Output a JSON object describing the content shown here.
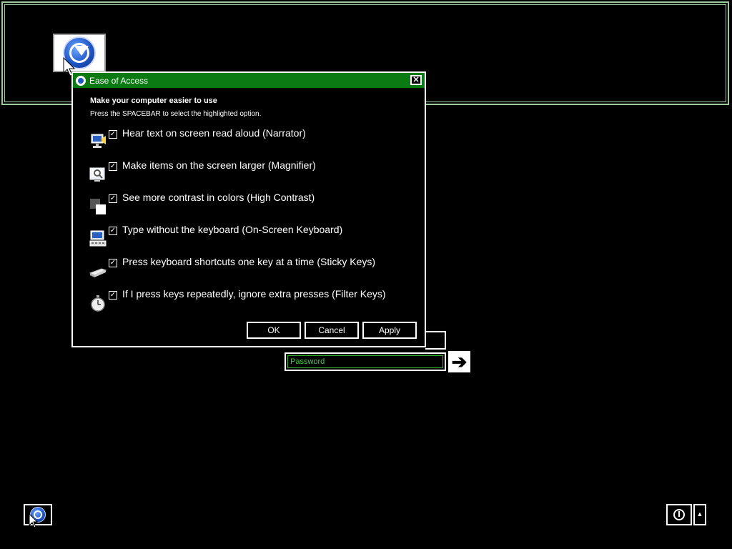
{
  "dialog": {
    "title": "Ease of Access",
    "close_glyph": "✕",
    "heading": "Make your computer easier to use",
    "subheading": "Press the SPACEBAR to select the highlighted option.",
    "options": [
      {
        "label": "Hear text on screen read aloud (Narrator)",
        "checked": true,
        "icon": "narrator-icon"
      },
      {
        "label": "Make items on the screen larger (Magnifier)",
        "checked": true,
        "icon": "magnifier-icon"
      },
      {
        "label": "See more contrast in colors (High Contrast)",
        "checked": true,
        "icon": "high-contrast-icon"
      },
      {
        "label": "Type without the keyboard (On-Screen Keyboard)",
        "checked": true,
        "icon": "on-screen-keyboard-icon"
      },
      {
        "label": "Press keyboard shortcuts one key at a time (Sticky Keys)",
        "checked": true,
        "icon": "sticky-keys-icon"
      },
      {
        "label": "If I press keys repeatedly, ignore extra presses (Filter Keys)",
        "checked": true,
        "icon": "filter-keys-icon"
      }
    ],
    "ok_label": "OK",
    "cancel_label": "Cancel",
    "apply_label": "Apply"
  },
  "login": {
    "password_placeholder": "Password",
    "submit_glyph": "➔"
  },
  "checkmark_glyph": "✓",
  "power_menu_glyph": "▲",
  "colors": {
    "titlebar": "#0b7a12",
    "accent_green": "#3fd23f",
    "panel_border": "#9fc99f"
  }
}
